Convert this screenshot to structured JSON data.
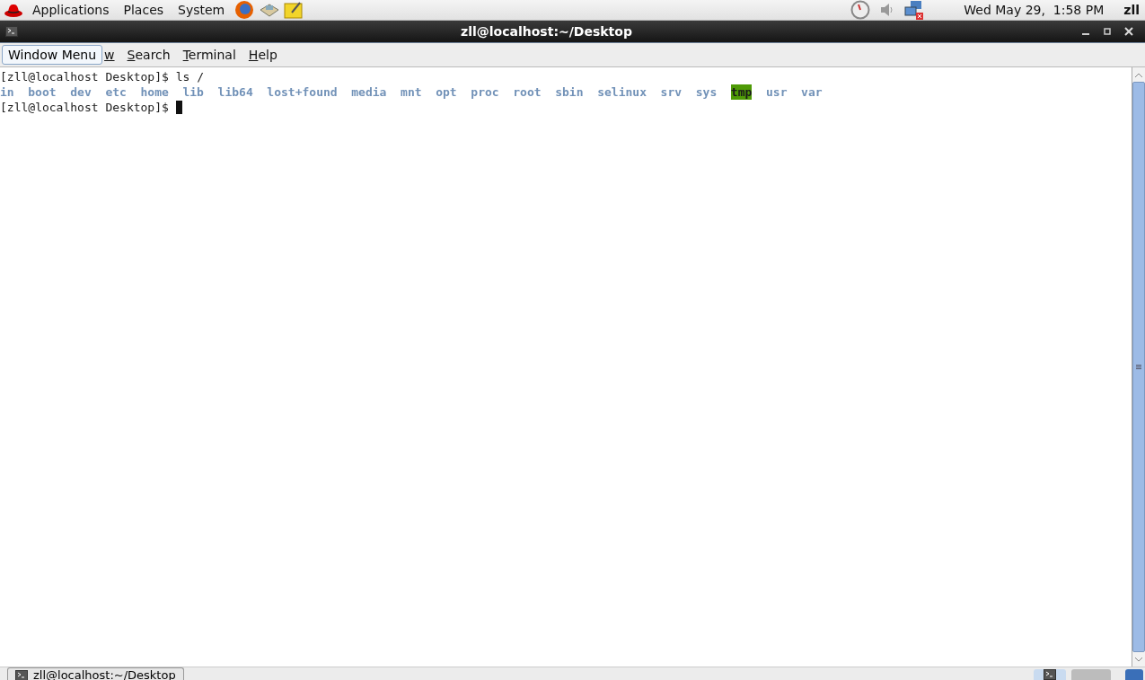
{
  "top_panel": {
    "menus": [
      "Applications",
      "Places",
      "System"
    ],
    "clock": "Wed May 29,  1:58 PM",
    "user": "zll"
  },
  "window": {
    "title": "zll@localhost:~/Desktop"
  },
  "menu_bar": {
    "tooltip": "Window Menu",
    "items": [
      "w",
      "Search",
      "Terminal",
      "Help"
    ]
  },
  "terminal": {
    "lines": [
      {
        "kind": "prompt",
        "prompt": "[zll@localhost Desktop]$",
        "command": "ls /",
        "cursor": false
      },
      {
        "kind": "listing",
        "entries": [
          {
            "name": "in",
            "kind": "dir"
          },
          {
            "name": "boot",
            "kind": "dir"
          },
          {
            "name": "dev",
            "kind": "dir"
          },
          {
            "name": "etc",
            "kind": "dir"
          },
          {
            "name": "home",
            "kind": "dir"
          },
          {
            "name": "lib",
            "kind": "dir"
          },
          {
            "name": "lib64",
            "kind": "dir"
          },
          {
            "name": "lost+found",
            "kind": "dir"
          },
          {
            "name": "media",
            "kind": "dir"
          },
          {
            "name": "mnt",
            "kind": "dir"
          },
          {
            "name": "opt",
            "kind": "dir"
          },
          {
            "name": "proc",
            "kind": "dir"
          },
          {
            "name": "root",
            "kind": "dir"
          },
          {
            "name": "sbin",
            "kind": "dir"
          },
          {
            "name": "selinux",
            "kind": "dir"
          },
          {
            "name": "srv",
            "kind": "dir"
          },
          {
            "name": "sys",
            "kind": "dir"
          },
          {
            "name": "tmp",
            "kind": "sticky"
          },
          {
            "name": "usr",
            "kind": "dir"
          },
          {
            "name": "var",
            "kind": "dir"
          }
        ]
      },
      {
        "kind": "prompt",
        "prompt": "[zll@localhost Desktop]$",
        "cursor": true
      }
    ]
  },
  "taskbar": {
    "tasks": [
      {
        "label": "zll@localhost:~/Desktop",
        "selected": false
      }
    ],
    "workspaces": [
      {
        "selected": true
      },
      {
        "selected": false
      }
    ]
  }
}
